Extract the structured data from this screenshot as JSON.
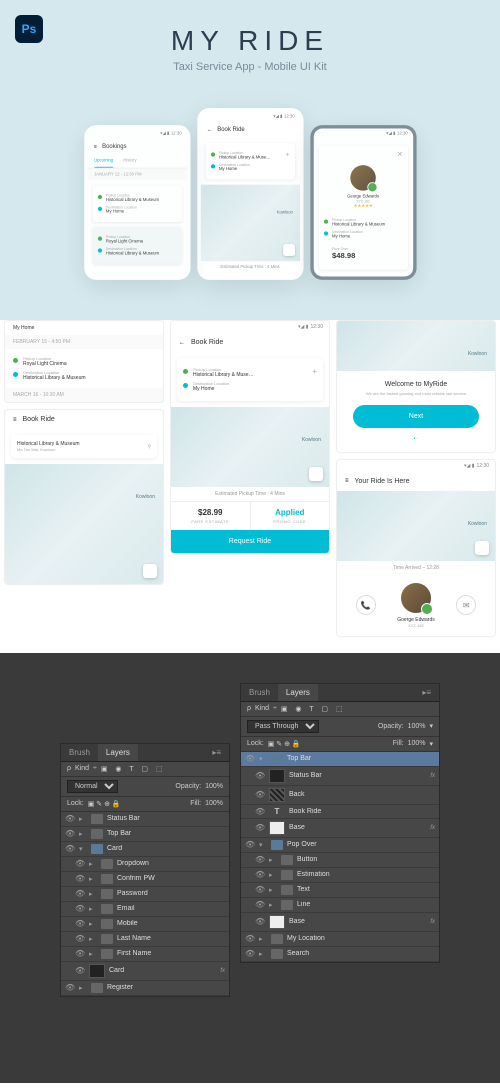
{
  "hero": {
    "ps": "Ps",
    "title": "MY RIDE",
    "subtitle": "Taxi Service App - Mobile UI Kit"
  },
  "status": {
    "time": "12:30",
    "icons": "▾◢ ▮"
  },
  "bookings": {
    "title": "Bookings",
    "tabs": {
      "upcoming": "Upcoming",
      "history": "History"
    },
    "date1": "JANUARY 12 - 12:30 PM",
    "pickup_lbl": "Pickup Location",
    "pickup_val": "Historical Library & Museum",
    "dest_lbl": "Destination Location",
    "dest_val": "My Home",
    "date2": "FEBRUARY 15 - 4:50 PM",
    "pickup2_val": "Royal Light Cinema",
    "dest2_val": "Historical Library & Museum",
    "date3": "MARCH 16 - 10:30 AM"
  },
  "bookride": {
    "title": "Book Ride",
    "pickup_lbl": "Pickup Location",
    "pickup_val": "Historical Library & Muse…",
    "dest_lbl": "Destination Location",
    "dest_val": "My Home",
    "est": "Estimated Pickup Time : 4 Mins",
    "search_val": "Historical Library & Museum",
    "search_sub": "Ma Tau Wai, Kowloon",
    "fare": "$28.99",
    "fare_lbl": "FARE ESTIMATE",
    "promo": "Applied",
    "promo_lbl": "PROMO CODE",
    "request": "Request Ride"
  },
  "driver": {
    "name": "George Edwards",
    "id": "XYZ-182",
    "stars": "★★★★★",
    "pickup_val": "Historical Library & Museum",
    "dest_val": "My Home",
    "price_lbl": "Price Over",
    "price": "$48.98"
  },
  "welcome": {
    "title": "Welcome to MyRide",
    "text": "We are the fastest growing and most reliable taxi service",
    "next": "Next"
  },
  "arrived": {
    "title": "Your Ride Is Here",
    "time": "Time Arrived – 12:28",
    "name": "Goerge Edwards",
    "id": "XYZ-182"
  },
  "ps_panels": {
    "brush": "Brush",
    "layers": "Layers",
    "kind": "Kind",
    "blend1": "Normal",
    "blend2": "Pass Through",
    "opacity_lbl": "Opacity:",
    "opacity": "100%",
    "lock_lbl": "Lock:",
    "fill_lbl": "Fill:",
    "fill": "100%",
    "left": {
      "l0": "Status Bar",
      "l1": "Top Bar",
      "l2": "Card",
      "l3": "Dropdown",
      "l4": "Confrim PW",
      "l5": "Password",
      "l6": "Email",
      "l7": "Mobile",
      "l8": "Last Name",
      "l9": "First Name",
      "l10": "Card",
      "l11": "Register"
    },
    "right": {
      "l0": "Top Bar",
      "l1": "Status Bar",
      "l2": "Back",
      "l3": "Book Ride",
      "l4": "Base",
      "l5": "Pop Over",
      "l6": "Button",
      "l7": "Estimation",
      "l8": "Text",
      "l9": "Line",
      "l10": "Base",
      "l11": "My Location",
      "l12": "Search"
    },
    "fx": "fx"
  }
}
